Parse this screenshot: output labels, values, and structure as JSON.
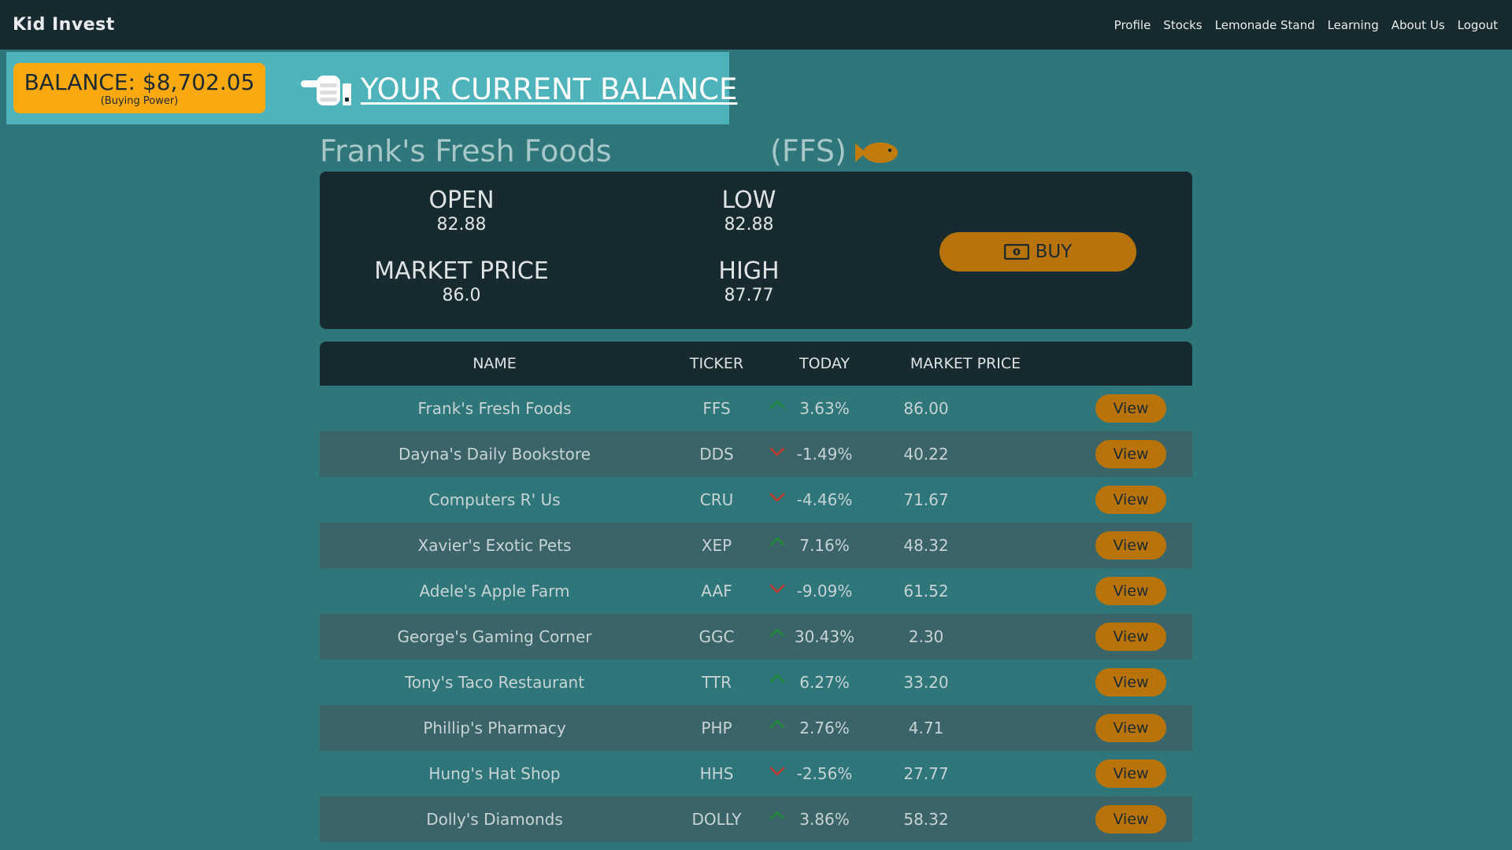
{
  "app": {
    "logo": "Kid Invest"
  },
  "nav": [
    {
      "label": "Profile"
    },
    {
      "label": "Stocks"
    },
    {
      "label": "Lemonade Stand"
    },
    {
      "label": "Learning"
    },
    {
      "label": "About Us"
    },
    {
      "label": "Logout"
    }
  ],
  "balance": {
    "main": "BALANCE: $8,702.05",
    "sub": "(Buying Power)",
    "link": "YOUR CURRENT BALANCE"
  },
  "stock": {
    "name": "Frank's Fresh Foods",
    "ticker": "(FFS)",
    "open_label": "OPEN",
    "open_value": "82.88",
    "low_label": "LOW",
    "low_value": "82.88",
    "market_label": "MARKET PRICE",
    "market_value": "86.0",
    "high_label": "HIGH",
    "high_value": "87.77",
    "buy_label": "BUY"
  },
  "table": {
    "headers": {
      "name": "NAME",
      "ticker": "TICKER",
      "today": "TODAY",
      "price": "MARKET PRICE"
    },
    "view_label": "View",
    "rows": [
      {
        "name": "Frank's Fresh Foods",
        "ticker": "FFS",
        "direction": "up",
        "today": "3.63%",
        "price": "86.00"
      },
      {
        "name": "Dayna's Daily Bookstore",
        "ticker": "DDS",
        "direction": "down",
        "today": "-1.49%",
        "price": "40.22"
      },
      {
        "name": "Computers R' Us",
        "ticker": "CRU",
        "direction": "down",
        "today": "-4.46%",
        "price": "71.67"
      },
      {
        "name": "Xavier's Exotic Pets",
        "ticker": "XEP",
        "direction": "up",
        "today": "7.16%",
        "price": "48.32"
      },
      {
        "name": "Adele's Apple Farm",
        "ticker": "AAF",
        "direction": "down",
        "today": "-9.09%",
        "price": "61.52"
      },
      {
        "name": "George's Gaming Corner",
        "ticker": "GGC",
        "direction": "up",
        "today": "30.43%",
        "price": "2.30"
      },
      {
        "name": "Tony's Taco Restaurant",
        "ticker": "TTR",
        "direction": "up",
        "today": "6.27%",
        "price": "33.20"
      },
      {
        "name": "Phillip's Pharmacy",
        "ticker": "PHP",
        "direction": "up",
        "today": "2.76%",
        "price": "4.71"
      },
      {
        "name": "Hung's Hat Shop",
        "ticker": "HHS",
        "direction": "down",
        "today": "-2.56%",
        "price": "27.77"
      },
      {
        "name": "Dolly's Diamonds",
        "ticker": "DOLLY",
        "direction": "up",
        "today": "3.86%",
        "price": "58.32"
      }
    ]
  },
  "colors": {
    "up": "#1f8a3a",
    "down": "#c0392b",
    "accent": "#b8740a",
    "balance": "#fca90f"
  }
}
